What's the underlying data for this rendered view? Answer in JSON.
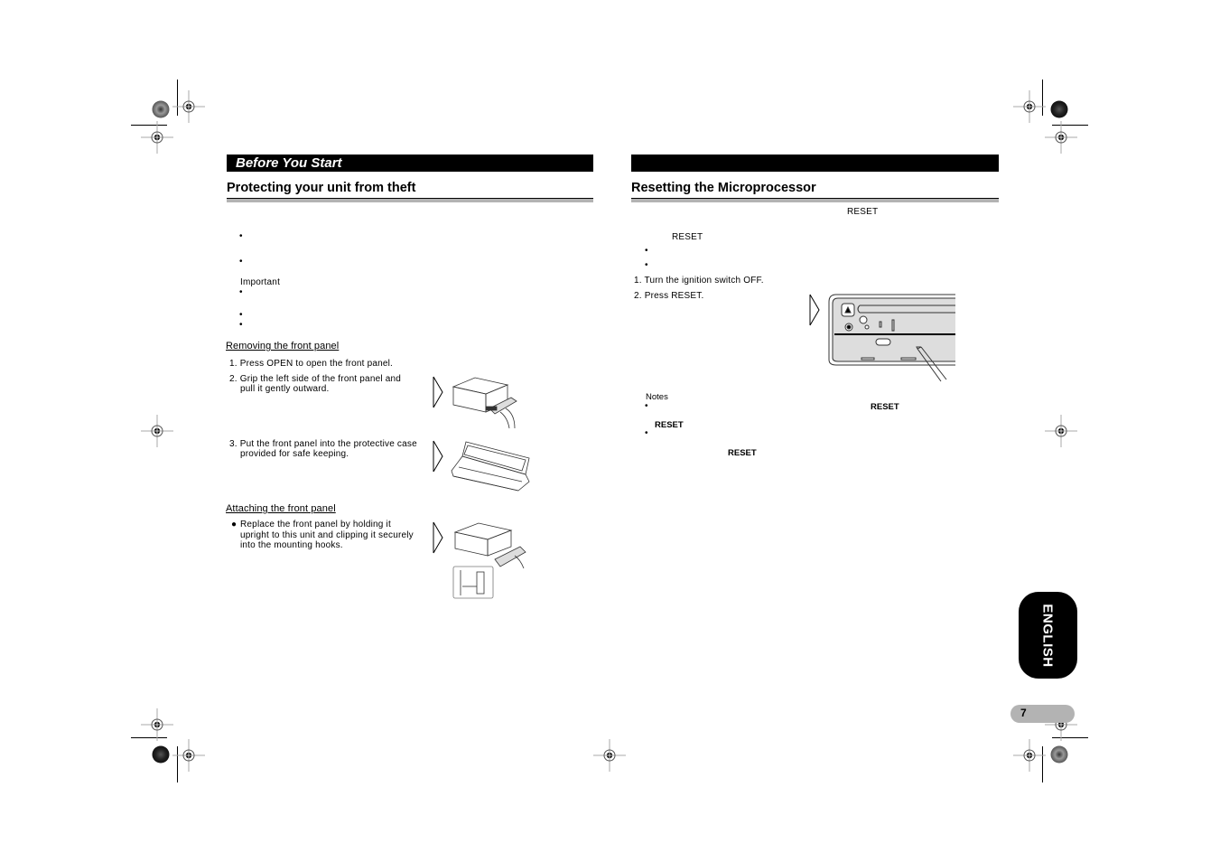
{
  "left_page": {
    "section_title": "Before You Start",
    "heading": "Protecting your unit from theft",
    "important_label": "Important",
    "removing": {
      "title": "Removing the front panel",
      "steps": [
        "1.  Press OPEN to open the front panel.",
        "2.  Grip the left side of the front panel and",
        "pull it gently outward.",
        "3.  Put the front panel into the protective case",
        "provided for safe keeping."
      ]
    },
    "attaching": {
      "title": "Attaching the front panel",
      "bullet_lines": [
        "Replace the front panel by holding it",
        "upright to this unit and clipping it securely",
        "into the mounting hooks."
      ]
    }
  },
  "right_page": {
    "section_title": "",
    "heading": "Resetting the Microprocessor",
    "reset_word": "RESET",
    "steps": [
      "1. Turn the ignition switch OFF.",
      "2. Press RESET."
    ],
    "notes_label": "Notes"
  },
  "language_tab": "ENGLISH",
  "page_number": "7",
  "icons": {
    "registration_mark": "crosshair-circle",
    "color_target": "halftone-disc",
    "step_arrow": "chevron-right-outline"
  }
}
